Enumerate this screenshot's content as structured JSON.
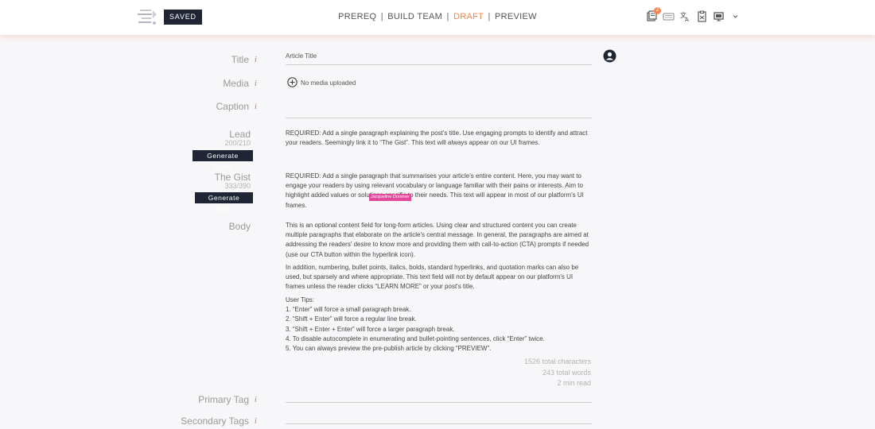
{
  "header": {
    "saved_label": "SAVED",
    "nav": {
      "prereq": "PREREQ",
      "build_team": "BUILD TEAM",
      "draft": "DRAFT",
      "preview": "PREVIEW",
      "separator": "|"
    },
    "notification_count": "2",
    "accent_color": "#ef8a50",
    "icons": [
      "articles-icon",
      "keyboard-icon",
      "translate-icon",
      "clipboard-icon",
      "monitor-icon",
      "chevron-down-icon"
    ]
  },
  "form": {
    "title": {
      "label": "Title",
      "info": "i",
      "placeholder": "Article Title"
    },
    "media": {
      "label": "Media",
      "info": "i",
      "status": "No media uploaded"
    },
    "caption": {
      "label": "Caption",
      "info": "i"
    },
    "lead": {
      "label": "Lead",
      "counter": "200/210",
      "button": "Generate Lead",
      "text": "REQUIRED: Add a single paragraph explaining the post's title. Use engaging prompts to identify and attract your readers. Seemingly link it to “The Gist”. This text will always appear on our UI frames."
    },
    "gist": {
      "label": "The Gist",
      "counter": "333/390",
      "button": "Generate Gist",
      "text": "REQUIRED: Add a single paragraph that summarises your article's entire content. Here, you may want to engage your readers by using relevant vocabulary or language familiar with their pains or interests. Aim to highlight added values or solutions specific to their needs. This text will appear in most of our platform's UI frames.",
      "tag": "Jacqueline Dommer"
    },
    "body": {
      "label": "Body",
      "paragraph1": "This is an optional content field for long-form articles. Using clear and structured content you can create multiple paragraphs that elaborate on the article's central message. In general, the paragraphs are aimed at addressing the readers' desire to know more and providing them with call-to-action (CTA) prompts if needed (use our CTA button within the hyperlink icon).",
      "paragraph2": "In addition, numbering, bullet points, italics, bolds, standard hyperlinks, and quotation marks can also be used, but sparsely and where appropriate. This text field will not by default appear on our platform's UI frames unless the reader clicks “LEARN MORE” or your post's title.",
      "tips_title": "User Tips:",
      "tips": [
        "1. “Enter” will force a small paragraph break.",
        "2. “Shift + Enter” will force a regular line break.",
        "3. “Shift + Enter + Enter” will force a larger paragraph break.",
        "4. To disable autocomplete in enumerating and bullet-pointing sentences, click “Enter” twice.",
        "5. You can always preview the pre-publish article by clicking “PREVIEW”."
      ],
      "stats": {
        "characters": "1526 total characters",
        "words": "243 total words",
        "read_time": "2 min read"
      }
    },
    "primary_tag": {
      "label": "Primary Tag",
      "info": "i"
    },
    "secondary_tags": {
      "label": "Secondary Tags",
      "info": "i"
    }
  }
}
